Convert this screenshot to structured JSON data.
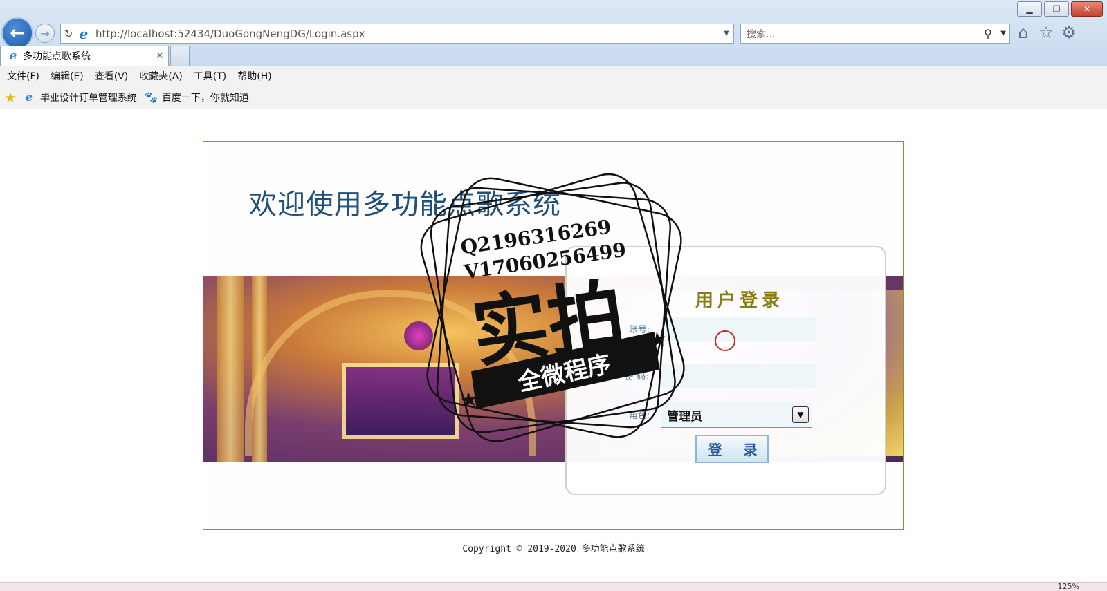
{
  "browser": {
    "address": "http://localhost:52434/DuoGongNengDG/Login.aspx",
    "address_host": "localhost",
    "search_placeholder": "搜索...",
    "tab_title": "多功能点歌系统",
    "tab_close": "✕",
    "window_buttons": {
      "minimize": "▁",
      "restore": "❐",
      "close": "✕"
    }
  },
  "menu": {
    "items": [
      "文件(F)",
      "编辑(E)",
      "查看(V)",
      "收藏夹(A)",
      "工具(T)",
      "帮助(H)"
    ]
  },
  "favorites": {
    "items": [
      {
        "label": "毕业设计订单管理系统",
        "icon": "ie-page-icon"
      },
      {
        "label": "百度一下，你就知道",
        "icon": "baidu-paw-icon"
      }
    ]
  },
  "page": {
    "welcome": "欢迎使用多功能点歌系统",
    "login_title": "用户登录",
    "account_label": "账号:",
    "password_label": "密 码:",
    "role_label": "角色:",
    "role_selected": "管理员",
    "login_button": "登 录",
    "copyright": "Copyright © 2019-2020 多功能点歌系统"
  },
  "watermark": {
    "line1": "Q2196316269",
    "line2": "V17060256499",
    "big": "实拍",
    "ribbon": "全微程序"
  },
  "statusbar": {
    "zoom": "125%"
  },
  "colors": {
    "accent": "#1f4f7a",
    "login_title": "#8a7a12",
    "input_border": "#5e98b8",
    "frame_border": "#9a8b2a"
  }
}
